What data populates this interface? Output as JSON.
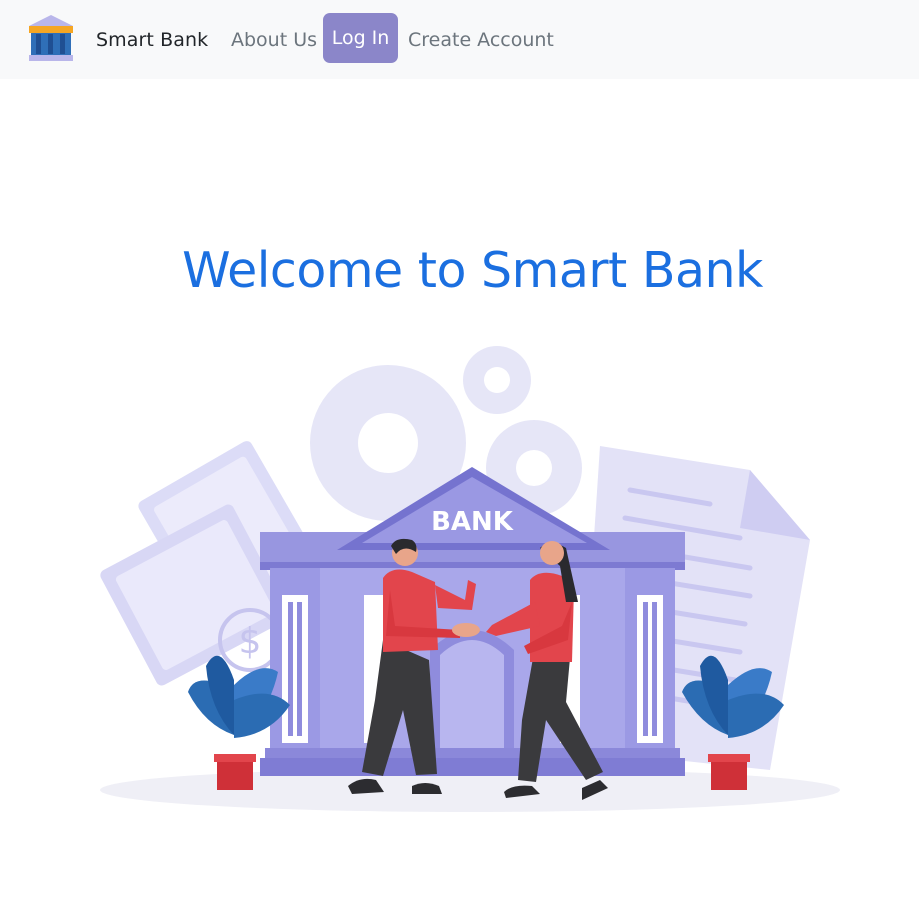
{
  "navbar": {
    "brand": "Smart Bank",
    "links": [
      {
        "label": "About Us"
      },
      {
        "label": "Log In"
      },
      {
        "label": "Create Account"
      }
    ],
    "active_link_color": "#8b86c9"
  },
  "hero": {
    "title": "Welcome to Smart Bank",
    "title_color": "#1b6fe0"
  },
  "illustration": {
    "sign_text": "BANK",
    "currency_symbol": "$"
  }
}
